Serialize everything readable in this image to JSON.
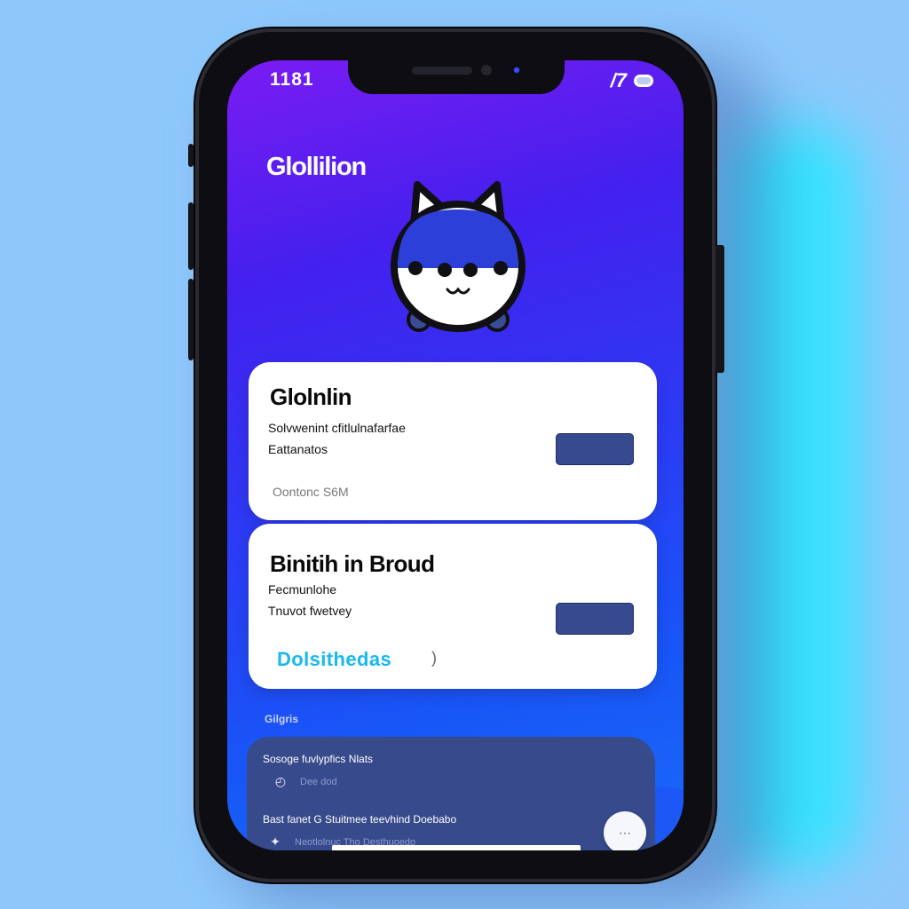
{
  "status": {
    "time": "1181",
    "signal": "/7"
  },
  "app": {
    "title": "Glollilion"
  },
  "card1": {
    "title": "Glolnlin",
    "line1": "Solvwenint cfitlulnafarfae",
    "line2": "Eattanatos",
    "meta": "Oontonc S6M"
  },
  "card2": {
    "title": "Binitih in Broud",
    "line1": "Fecmunlohe",
    "line2": "Tnuvot fwetvey",
    "link": "Dolsithedas",
    "chevron": ")"
  },
  "section": {
    "label": "Gilgris"
  },
  "panel": {
    "item1_title": "Sosoge fuvlypfics Nlats",
    "item1_sub": "Dee dod",
    "item2_title": "Bast fanet G Stuitmee teevhind Doebabo",
    "item2_sub": "Neotlolnuc Tho Desthuoedo"
  },
  "icons": {
    "clock": "clock-icon",
    "sparkle": "sparkle-icon",
    "fab": "handshake-icon"
  },
  "colors": {
    "accent": "#18b8f0",
    "button": "#37498f",
    "panel": "#374a8b"
  }
}
